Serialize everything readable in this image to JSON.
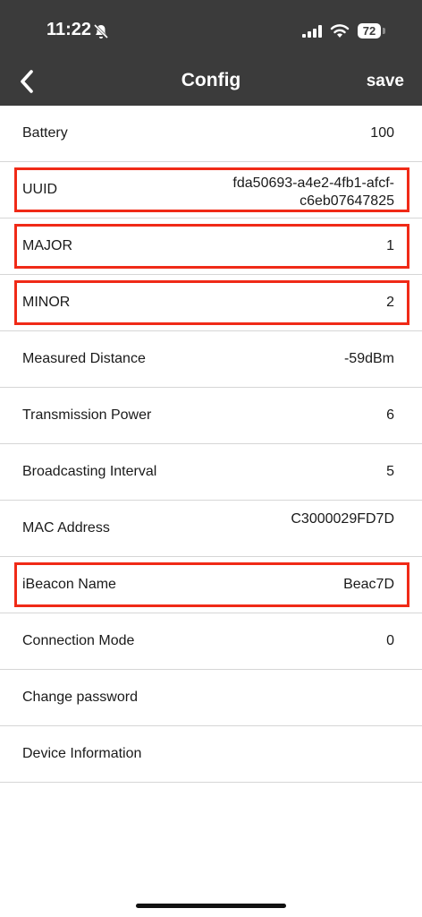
{
  "status_bar": {
    "time": "11:22",
    "battery": "72"
  },
  "nav": {
    "title": "Config",
    "save_label": "save"
  },
  "rows": [
    {
      "label": "Battery",
      "value": "100"
    },
    {
      "label": "UUID",
      "value": "fda50693-a4e2-4fb1-afcf-c6eb07647825"
    },
    {
      "label": "MAJOR",
      "value": "1"
    },
    {
      "label": "MINOR",
      "value": "2"
    },
    {
      "label": "Measured Distance",
      "value": "-59dBm"
    },
    {
      "label": "Transmission Power",
      "value": "6"
    },
    {
      "label": "Broadcasting Interval",
      "value": "5"
    },
    {
      "label": "MAC Address",
      "value": "C3000029FD7D"
    },
    {
      "label": "iBeacon Name",
      "value": "Beac7D"
    },
    {
      "label": "Connection Mode",
      "value": "0"
    },
    {
      "label": "Change password"
    },
    {
      "label": "Device Information"
    }
  ],
  "highlight_color": "#f02a17"
}
